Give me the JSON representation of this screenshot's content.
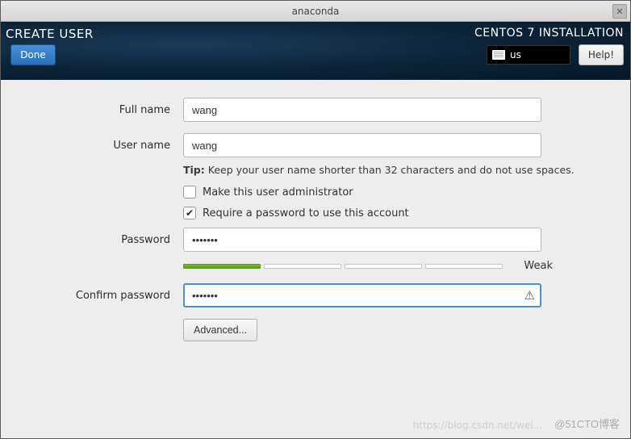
{
  "titlebar": {
    "title": "anaconda"
  },
  "header": {
    "page_title": "CREATE USER",
    "done_label": "Done",
    "install_title": "CENTOS 7 INSTALLATION",
    "keyboard_layout": "us",
    "help_label": "Help!"
  },
  "form": {
    "fullname_label": "Full name",
    "fullname_value": "wang",
    "username_label": "User name",
    "username_value": "wang",
    "tip_prefix": "Tip:",
    "tip_text": " Keep your user name shorter than 32 characters and do not use spaces.",
    "admin_checkbox_label": "Make this user administrator",
    "admin_checked": false,
    "require_pw_label": "Require a password to use this account",
    "require_pw_checked": true,
    "password_label": "Password",
    "password_value": "•••••••",
    "strength_label": "Weak",
    "confirm_label": "Confirm password",
    "confirm_value": "•••••••",
    "advanced_label": "Advanced..."
  },
  "watermark": "@51CTO博客",
  "watermark2": "https://blog.csdn.net/wei..."
}
